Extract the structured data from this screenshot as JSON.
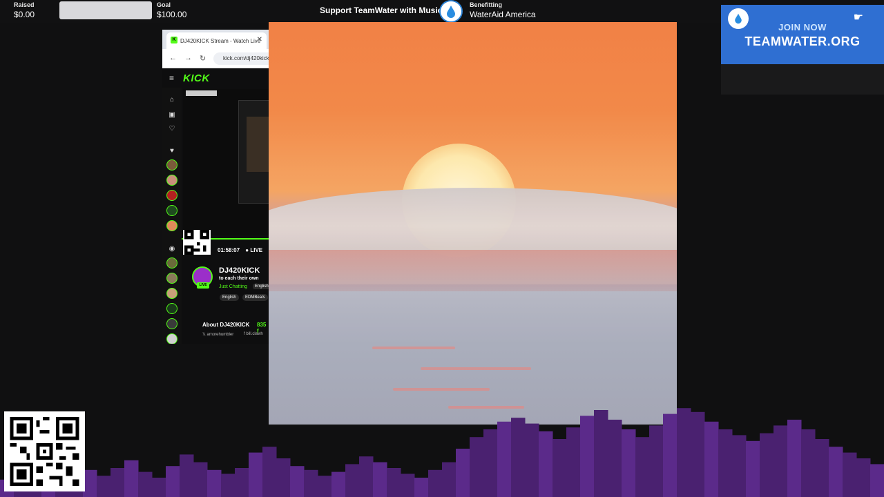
{
  "topbar": {
    "raised_label": "Raised",
    "raised_value": "$0.00",
    "goal_label": "Goal",
    "goal_value": "$100.00",
    "progress_fraction": 0.0,
    "support_text": "Support TeamWater with Music",
    "benefitting_label": "Benefitting",
    "benefitting_value": "WaterAid America",
    "accent": "#2fb6ff"
  },
  "banner": {
    "join_text": "JOIN NOW",
    "url_text": "TEAMWATER.ORG",
    "bg_color": "#2f6fd2"
  },
  "browser": {
    "tab_title": "DJ420KICK Stream - Watch Live",
    "url": "kick.com/dj420kick",
    "site_logo": "KICK",
    "stream_time": "01:58:07",
    "live_label": "LIVE",
    "channel_name": "DJ420KICK",
    "tagline": "to each their own",
    "category": "Just Chatting",
    "language": "English",
    "tags": [
      "English",
      "EDMBeats"
    ],
    "about_title": "About DJ420KICK",
    "followers": "835 f",
    "social_x": "amorehumbler",
    "social_fb": "bill.clawh",
    "accent": "#53fc18"
  },
  "icons": [
    "water-drop-icon",
    "back-arrow-icon",
    "forward-arrow-icon",
    "reload-icon",
    "hamburger-icon",
    "home-icon",
    "browse-icon",
    "heart-icon",
    "close-icon",
    "qr-code-icon",
    "pointing-hand-icon"
  ]
}
